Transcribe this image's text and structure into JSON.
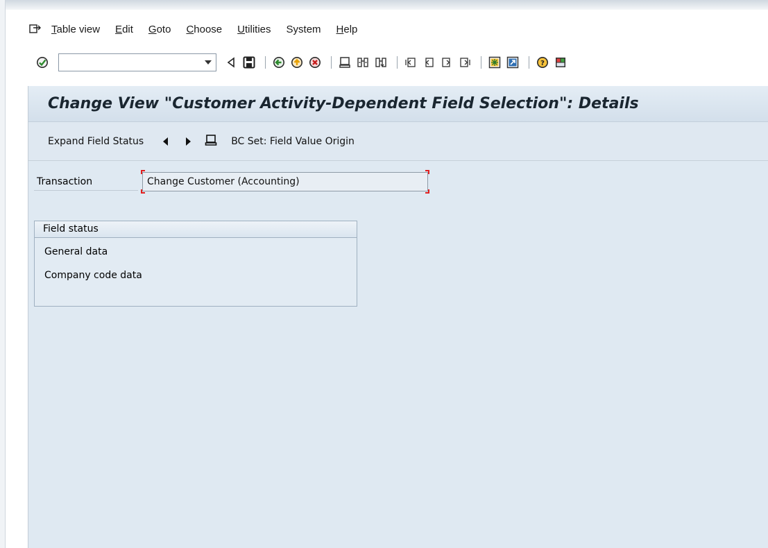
{
  "menubar": {
    "items": [
      {
        "label": "Table view",
        "underline": "T",
        "rest": "able view"
      },
      {
        "label": "Edit",
        "underline": "E",
        "rest": "dit"
      },
      {
        "label": "Goto",
        "underline": "G",
        "rest": "oto"
      },
      {
        "label": "Choose",
        "underline": "C",
        "rest": "hoose"
      },
      {
        "label": "Utilities",
        "underline": "U",
        "rest": "tilities"
      },
      {
        "label": "System",
        "underline": "",
        "rest": "System"
      },
      {
        "label": "Help",
        "underline": "H",
        "rest": "elp"
      }
    ]
  },
  "toolbar": {
    "command_value": "",
    "icons": [
      "enter-icon",
      "back-triangle-icon",
      "save-icon",
      "back-icon",
      "exit-icon",
      "cancel-icon",
      "print-icon",
      "find-icon",
      "find-next-icon",
      "first-page-icon",
      "previous-page-icon",
      "next-page-icon",
      "last-page-icon",
      "create-session-icon",
      "shortcut-icon",
      "help-icon",
      "layout-menu-icon"
    ]
  },
  "title": "Change View \"Customer Activity-Dependent Field Selection\": Details",
  "app_toolbar": {
    "expand_label": "Expand Field Status",
    "bcset_label": "BC Set: Field Value Origin"
  },
  "transaction": {
    "label": "Transaction",
    "value": "Change Customer (Accounting)"
  },
  "field_status": {
    "title": "Field status",
    "items": [
      "General data",
      "Company code data"
    ]
  },
  "colors": {
    "main_bg": "#dfe9f2",
    "required_mark": "#e02020",
    "enter_green": "#2e8b2e",
    "exit_orange": "#e8a000",
    "cancel_red": "#c81e1e"
  }
}
